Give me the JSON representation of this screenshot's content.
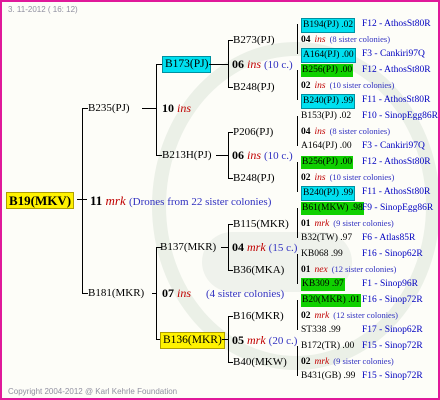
{
  "header": "3. 11-2012 ( 16: 12)",
  "footer": "Copyright 2004-2012 @ Karl Kehrle Foundation",
  "colors": {
    "border": "#e0199a",
    "cyan": "#00e0f0",
    "yellow": "#fff200",
    "green": "#10d000",
    "red": "#c00000",
    "blue": "#3030c0"
  },
  "root": {
    "label": "B19(MKV)",
    "num": "11",
    "type": "mrk",
    "note": "(Drones from 22 sister colonies)"
  },
  "gen1": {
    "top": {
      "label": "B235(PJ)",
      "num": "10",
      "type": "ins"
    },
    "bottom": {
      "label": "B181(MKR)",
      "num": "07",
      "type": "ins",
      "note": "(4 sister colonies)"
    }
  },
  "gen2": {
    "a": {
      "label": "B173(PJ)",
      "num": "06",
      "type": "ins",
      "note": "(10 c.)"
    },
    "b": {
      "label": "B213H(PJ)",
      "num": "06",
      "type": "ins",
      "note": "(10 c.)"
    },
    "c": {
      "label": "B137(MKR)",
      "num": "04",
      "type": "mrk",
      "note": "(15 c.)"
    },
    "d": {
      "label": "B136(MKR)",
      "num": "05",
      "type": "mrk",
      "note": "(20 c.)"
    }
  },
  "gen3": {
    "a1": "B273(PJ)",
    "a2": "B248(PJ)",
    "b1": "P206(PJ)",
    "b2": "B248(PJ)",
    "c1": "B115(MKR)",
    "c2": "B36(MKA)",
    "d1": "B16(MKR)",
    "d2": "B40(MKW)"
  },
  "gen4": [
    {
      "name": "B194(PJ) .02",
      "line": "F12 - AthosSt80R",
      "num": "04",
      "type": "ins",
      "note": "(8 sister colonies)",
      "name2": "A164(PJ) .00",
      "line2": "F3 - Cankiri97Q"
    },
    {
      "name": "B256(PJ) .00",
      "line": "F12 - AthosSt80R",
      "num": "02",
      "type": "ins",
      "note": "(10 sister colonies)",
      "name2": "B240(PJ) .99",
      "line2": "F11 - AthosSt80R"
    },
    {
      "name": "B153(PJ) .02",
      "line": "F10 - SinopEgg86R",
      "num": "04",
      "type": "ins",
      "note": "(8 sister colonies)",
      "name2": "A164(PJ) .00",
      "line2": "F3 - Cankiri97Q"
    },
    {
      "name": "B256(PJ) .00",
      "line": "F12 - AthosSt80R",
      "num": "02",
      "type": "ins",
      "note": "(10 sister colonies)",
      "name2": "B240(PJ) .99",
      "line2": "F11 - AthosSt80R"
    },
    {
      "name": "B61(MKW) .98",
      "line": "F9 - SinopEgg86R",
      "num": "01",
      "type": "mrk",
      "note": "(9 sister colonies)",
      "name2": "B32(TW) .97",
      "line2": "F6 - Atlas85R"
    },
    {
      "name": "KB068 .99",
      "line": "F16 - Sinop62R",
      "num": "01",
      "type": "nex",
      "note": "(12 sister colonies)",
      "name2": "KB309 .97",
      "line2": "F1 - Sinop96R"
    },
    {
      "name": "B20(MKR) .01",
      "line": "F16 - Sinop72R",
      "num": "02",
      "type": "mrk",
      "note": "(12 sister colonies)",
      "name2": "ST338 .99",
      "line2": "F17 - Sinop62R"
    },
    {
      "name": "B172(TR) .00",
      "line": "F15 - Sinop72R",
      "num": "02",
      "type": "mrk",
      "note": "(9 sister colonies)",
      "name2": "B431(GB) .99",
      "line2": "F15 - Sinop72R"
    }
  ]
}
